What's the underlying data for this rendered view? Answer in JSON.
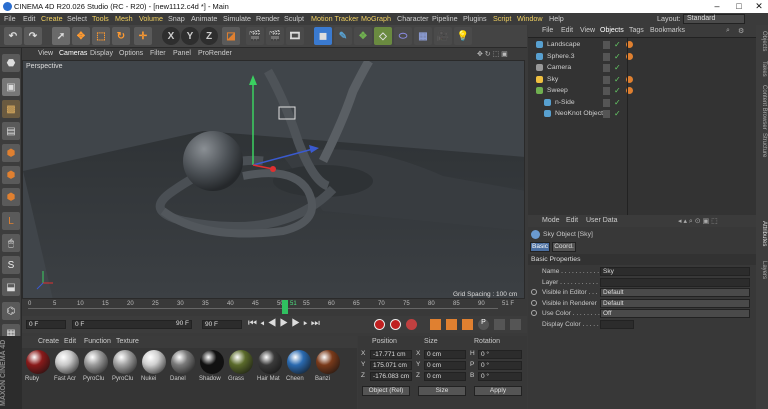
{
  "titlebar": {
    "title": "CINEMA 4D R20.026 Studio (RC - R20) - [new1112.c4d *] - Main"
  },
  "menu": {
    "items": [
      "File",
      "Edit",
      "Create",
      "Select",
      "Tools",
      "Mesh",
      "Volume",
      "Snap",
      "Animate",
      "Simulate",
      "Render",
      "Sculpt",
      "Motion Tracker",
      "MoGraph",
      "Character",
      "Pipeline",
      "Plugins",
      "Script",
      "Window",
      "Help"
    ],
    "layout_label": "Layout:",
    "layout_value": "Standard"
  },
  "toolbar": {
    "undo": "↶",
    "redo": "↷",
    "x": "X",
    "y": "Y",
    "z": "Z"
  },
  "viewport": {
    "menu": [
      "View",
      "Cameras",
      "Display",
      "Options",
      "Filter",
      "Panel",
      "ProRender"
    ],
    "name": "Perspective",
    "grid_spacing": "Grid Spacing : 100 cm"
  },
  "timeline": {
    "ticks": [
      "0",
      "5",
      "10",
      "15",
      "20",
      "25",
      "30",
      "35",
      "40",
      "45",
      "50",
      "55",
      "60",
      "65",
      "70",
      "75",
      "80",
      "85",
      "90"
    ],
    "current": "51",
    "end": "51 F"
  },
  "transport": {
    "start": "0 F",
    "cur": "0 F",
    "end1": "90 F",
    "end2": "90 F"
  },
  "materials": {
    "tabs": [
      "Create",
      "Edit",
      "Function",
      "Texture"
    ],
    "items": [
      {
        "label": "Ruby",
        "color": "#8a1a1a"
      },
      {
        "label": "Fast Acr",
        "color": "#c8c8c8"
      },
      {
        "label": "PyroClu",
        "color": "#9a9a9a"
      },
      {
        "label": "PyroClu",
        "color": "#a0a0a0"
      },
      {
        "label": "Nukei",
        "color": "#d0d0d0"
      },
      {
        "label": "Danel",
        "color": "#7a7a7a"
      },
      {
        "label": "Shadow",
        "color": "#111111"
      },
      {
        "label": "Grass",
        "color": "#5a6a2a"
      },
      {
        "label": "Hair Mat",
        "color": "#3a3a3a"
      },
      {
        "label": "Cheen",
        "color": "#2a6ab0"
      },
      {
        "label": "Banzi",
        "color": "#7a3a1a"
      }
    ]
  },
  "coords": {
    "headers": [
      "Position",
      "Size",
      "Rotation"
    ],
    "rows": [
      {
        "axis": "X",
        "pos": "-17.771 cm",
        "saxis": "X",
        "size": "0 cm",
        "raxis": "H",
        "rot": "0 °"
      },
      {
        "axis": "Y",
        "pos": "175.071 cm",
        "saxis": "Y",
        "size": "0 cm",
        "raxis": "P",
        "rot": "0 °"
      },
      {
        "axis": "Z",
        "pos": "-176.083 cm",
        "saxis": "Z",
        "size": "0 cm",
        "raxis": "B",
        "rot": "0 °"
      }
    ],
    "mode": "Object (Rel)",
    "size_mode": "Size",
    "apply": "Apply"
  },
  "objects": {
    "tabs": [
      "File",
      "Edit",
      "View",
      "Objects",
      "Tags",
      "Bookmarks"
    ],
    "rows": [
      {
        "name": "Landscape",
        "color": "#58a0d0",
        "indent": 0,
        "tag": true
      },
      {
        "name": "Sphere.3",
        "color": "#58a0d0",
        "indent": 0,
        "tag": true
      },
      {
        "name": "Camera",
        "color": "#999999",
        "indent": 0,
        "tag": false
      },
      {
        "name": "Sky",
        "color": "#f0c040",
        "indent": 0,
        "tag": true
      },
      {
        "name": "Sweep",
        "color": "#70b050",
        "indent": 0,
        "tag": true
      },
      {
        "name": "n-Side",
        "color": "#58a0d0",
        "indent": 1,
        "tag": false
      },
      {
        "name": "NeoKnot Object",
        "color": "#58a0d0",
        "indent": 1,
        "tag": false
      }
    ]
  },
  "attributes": {
    "tabs": [
      "Mode",
      "Edit",
      "User Data"
    ],
    "object_title": "Sky Object [Sky]",
    "subtabs": [
      "Basic",
      "Coord."
    ],
    "section": "Basic Properties",
    "props": [
      {
        "label": "Name . . . . . . . . . . . .",
        "value": "Sky"
      },
      {
        "label": "Layer . . . . . . . . . . . .",
        "value": ""
      },
      {
        "label": "Visible in Editor . . .",
        "value": "Default"
      },
      {
        "label": "Visible in Renderer",
        "value": "Default"
      },
      {
        "label": "Use Color . . . . . . . .",
        "value": "Off"
      },
      {
        "label": "Display Color . . . . .",
        "value": ""
      }
    ]
  },
  "rightstrip": [
    "Objects",
    "Takes",
    "Content Browser",
    "Structure",
    "Attributes",
    "Layers"
  ]
}
